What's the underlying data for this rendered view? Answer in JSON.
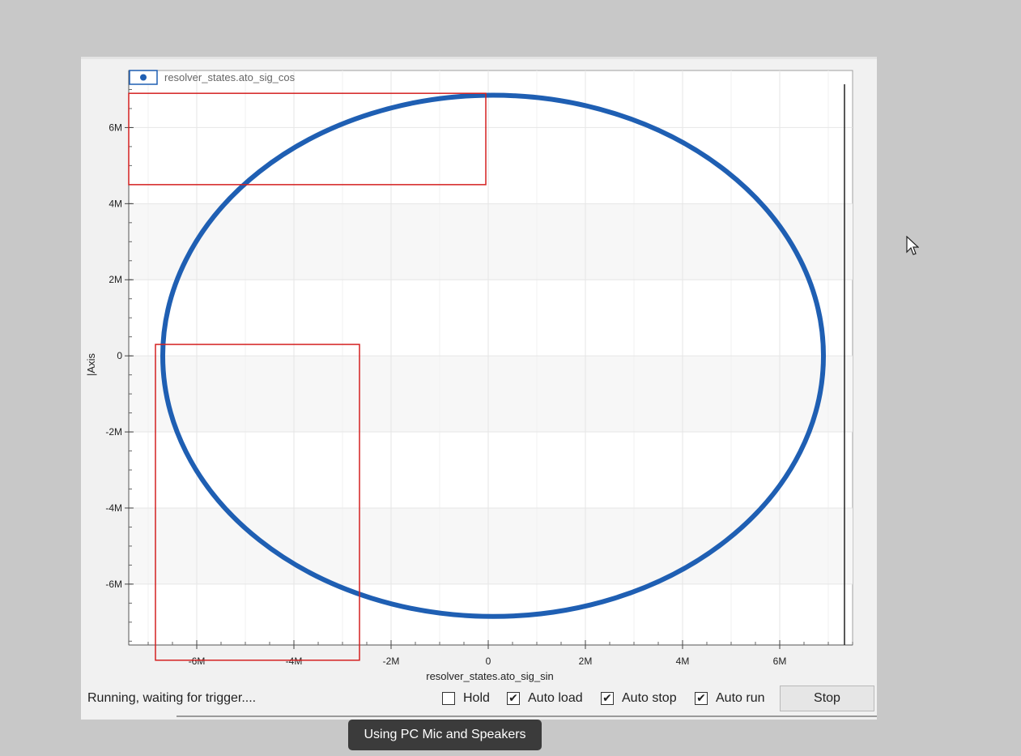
{
  "status_text": "Running, waiting for trigger....",
  "controls": {
    "hold": {
      "label": "Hold",
      "checked": false
    },
    "auto_load": {
      "label": "Auto load",
      "checked": true
    },
    "auto_stop": {
      "label": "Auto stop",
      "checked": true
    },
    "auto_run": {
      "label": "Auto run",
      "checked": true
    },
    "stop_label": "Stop"
  },
  "tooltip_text": "Using PC Mic and Speakers",
  "colors": {
    "series": "#1f5fb3",
    "highlight": "#d42020"
  },
  "chart_data": {
    "type": "scatter",
    "title": "",
    "xlabel": "resolver_states.ato_sig_sin",
    "ylabel": "|Axis",
    "xlim": [
      -7.4,
      7.5
    ],
    "ylim": [
      -7.6,
      7.5
    ],
    "x_unit_suffix": "M",
    "xticks": [
      -6,
      -4,
      -2,
      0,
      2,
      4,
      6
    ],
    "yticks": [
      -6,
      -4,
      -2,
      0,
      2,
      4,
      6
    ],
    "xtick_labels": [
      "-6M",
      "-4M",
      "-2M",
      "0",
      "2M",
      "4M",
      "6M"
    ],
    "ytick_labels": [
      "-6M",
      "-4M",
      "-2M",
      "0",
      "2M",
      "4M",
      "6M"
    ],
    "legend": {
      "position": "top-left",
      "entries": [
        "resolver_states.ato_sig_cos"
      ]
    },
    "grid": true,
    "series": [
      {
        "name": "resolver_states.ato_sig_cos",
        "shape": "ellipse",
        "center": [
          0.1,
          0
        ],
        "radius_x": 6.8,
        "radius_y": 6.85
      }
    ],
    "annotation_boxes": [
      {
        "x_range": [
          -7.4,
          -0.05
        ],
        "y_range": [
          4.5,
          6.9
        ]
      },
      {
        "x_range": [
          -6.85,
          -2.65
        ],
        "y_range": [
          -8.0,
          0.3
        ]
      }
    ]
  }
}
